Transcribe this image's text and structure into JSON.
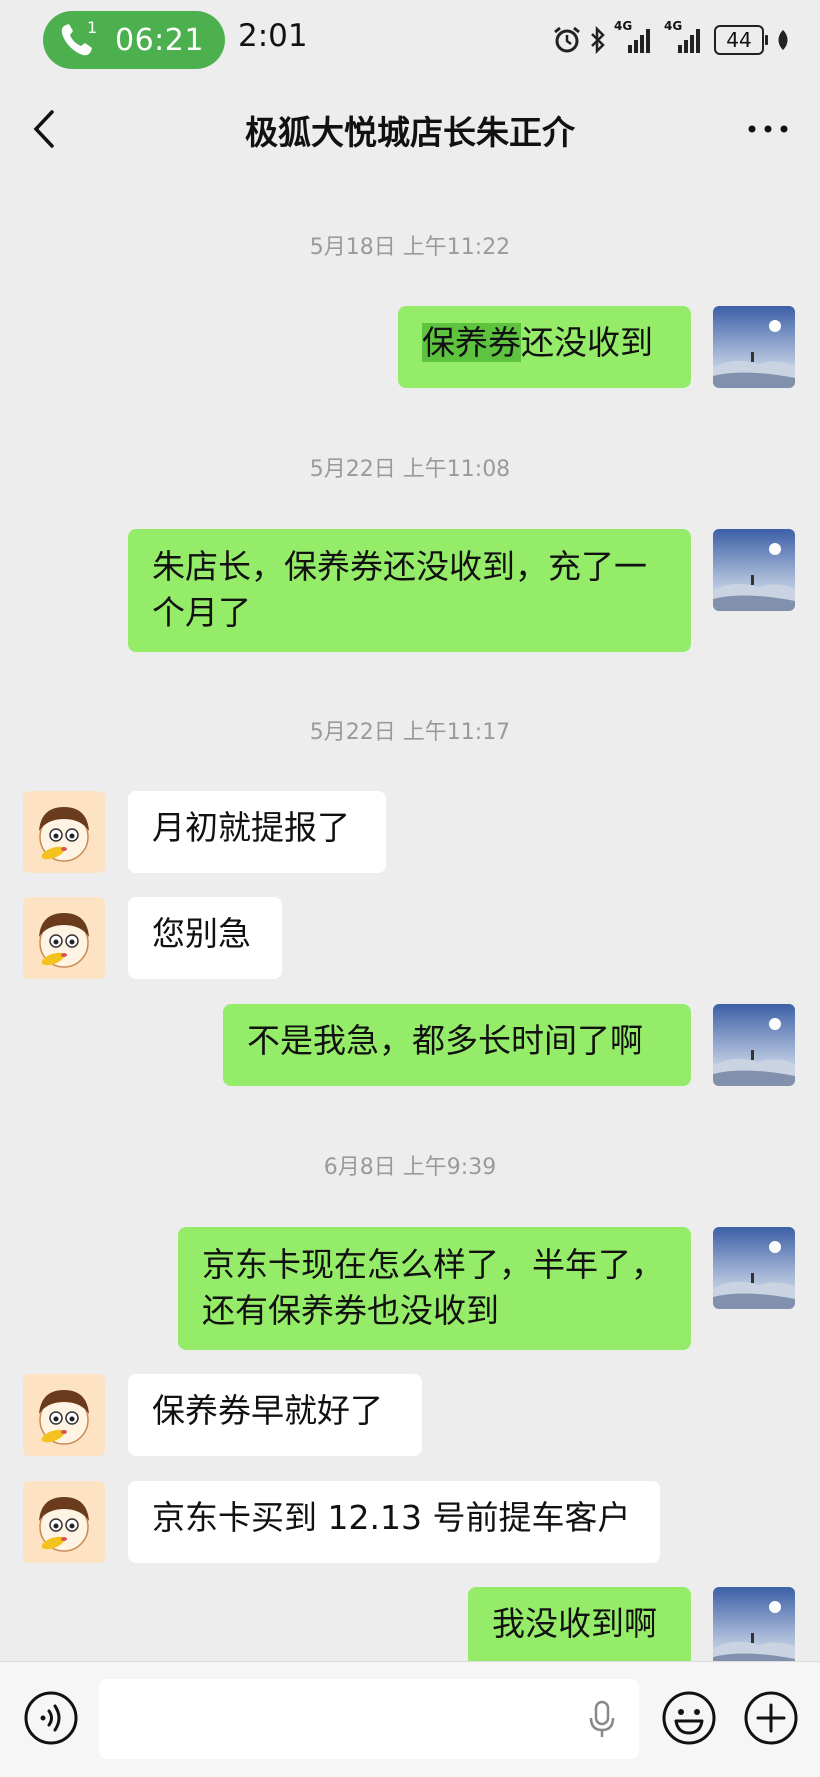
{
  "status_bar": {
    "call_timer": "06:21",
    "call_badge": "1",
    "clock": "2:01",
    "network_1": "4G",
    "network_2": "4G",
    "battery": "44"
  },
  "header": {
    "title": "极狐大悦城店长朱正介"
  },
  "messages": [
    {
      "type": "timestamp",
      "text": "5月18日 上午11:22"
    },
    {
      "type": "sent",
      "text_highlight": "保养券",
      "text_rest": "还没收到"
    },
    {
      "type": "timestamp",
      "text": "5月22日 上午11:08"
    },
    {
      "type": "sent",
      "line1": "朱店长，保养券还没收到，充了一",
      "line2": "个月了"
    },
    {
      "type": "timestamp",
      "text": "5月22日 上午11:17"
    },
    {
      "type": "received",
      "text": "月初就提报了"
    },
    {
      "type": "received",
      "text": "您别急"
    },
    {
      "type": "sent",
      "text": "不是我急，都多长时间了啊"
    },
    {
      "type": "timestamp",
      "text": "6月8日 上午9:39"
    },
    {
      "type": "sent",
      "line1": "京东卡现在怎么样了，半年了，",
      "line2": "还有保养券也没收到"
    },
    {
      "type": "received",
      "text": "保养券早就好了"
    },
    {
      "type": "received",
      "text": "京东卡买到 12.13 号前提车客户"
    },
    {
      "type": "sent",
      "text": "我没收到啊"
    }
  ],
  "input": {
    "value": ""
  },
  "colors": {
    "sent_bubble": "#95ec69",
    "received_bubble": "#ffffff",
    "background": "#ededed",
    "call_pill": "#4cb04f"
  }
}
